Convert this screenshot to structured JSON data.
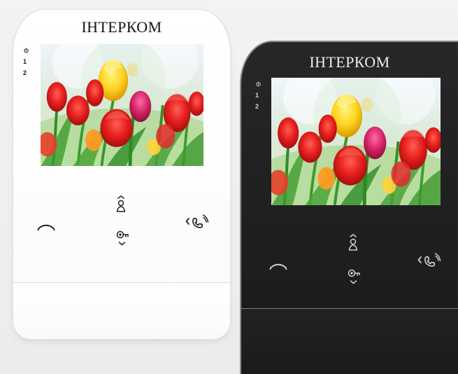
{
  "scene": {
    "devices": [
      {
        "id": "white",
        "brand": "ІНТЕРКОМ",
        "indicators": [
          "1",
          "2"
        ],
        "power_icon": "power-icon",
        "controls": {
          "end_icon": "handset-end-icon",
          "up_icon": "chevron-up-person-icon",
          "down_icon": "key-chevron-down-icon",
          "answer_icon": "chevron-left-handset-icon"
        },
        "colors": {
          "body": "#ffffff",
          "text": "#141414",
          "icon": "#222222"
        }
      },
      {
        "id": "black",
        "brand": "ІНТЕРКОМ",
        "indicators": [
          "1",
          "2"
        ],
        "power_icon": "power-icon",
        "controls": {
          "end_icon": "handset-end-icon",
          "up_icon": "chevron-up-person-icon",
          "down_icon": "key-chevron-down-icon",
          "answer_icon": "chevron-left-handset-icon"
        },
        "colors": {
          "body": "#222222",
          "text": "#ededed",
          "icon": "#cfcfcf"
        }
      }
    ]
  }
}
